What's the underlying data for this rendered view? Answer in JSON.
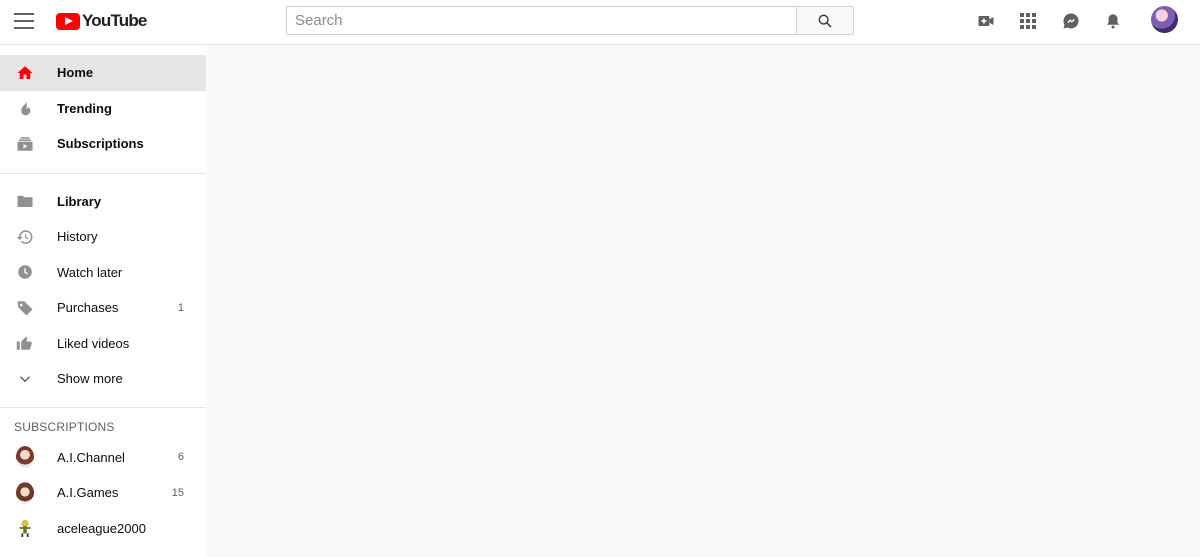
{
  "header": {
    "logo_text": "YouTube",
    "search_placeholder": "Search",
    "icons": [
      "menu-icon",
      "search-icon",
      "video-camera-icon",
      "apps-grid-icon",
      "messages-icon",
      "notifications-bell-icon",
      "avatar"
    ]
  },
  "sidebar": {
    "primary": [
      {
        "label": "Home",
        "icon": "home-icon",
        "active": true
      },
      {
        "label": "Trending",
        "icon": "flame-icon"
      },
      {
        "label": "Subscriptions",
        "icon": "subscriptions-icon"
      }
    ],
    "library": [
      {
        "label": "Library",
        "icon": "folder-icon"
      },
      {
        "label": "History",
        "icon": "history-icon"
      },
      {
        "label": "Watch later",
        "icon": "clock-icon"
      },
      {
        "label": "Purchases",
        "icon": "tag-icon",
        "count": "1"
      },
      {
        "label": "Liked videos",
        "icon": "thumbs-up-icon"
      },
      {
        "label": "Show more",
        "icon": "chevron-down-icon"
      }
    ],
    "subscriptions_header": "SUBSCRIPTIONS",
    "subscriptions": [
      {
        "label": "A.I.Channel",
        "count": "6"
      },
      {
        "label": "A.I.Games",
        "count": "15"
      },
      {
        "label": "aceleague2000"
      }
    ]
  },
  "colors": {
    "brand_red": "#ff0000",
    "active_bg": "#e5e5e5",
    "icon_gray": "#606060",
    "page_bg": "#f9f9f9"
  }
}
